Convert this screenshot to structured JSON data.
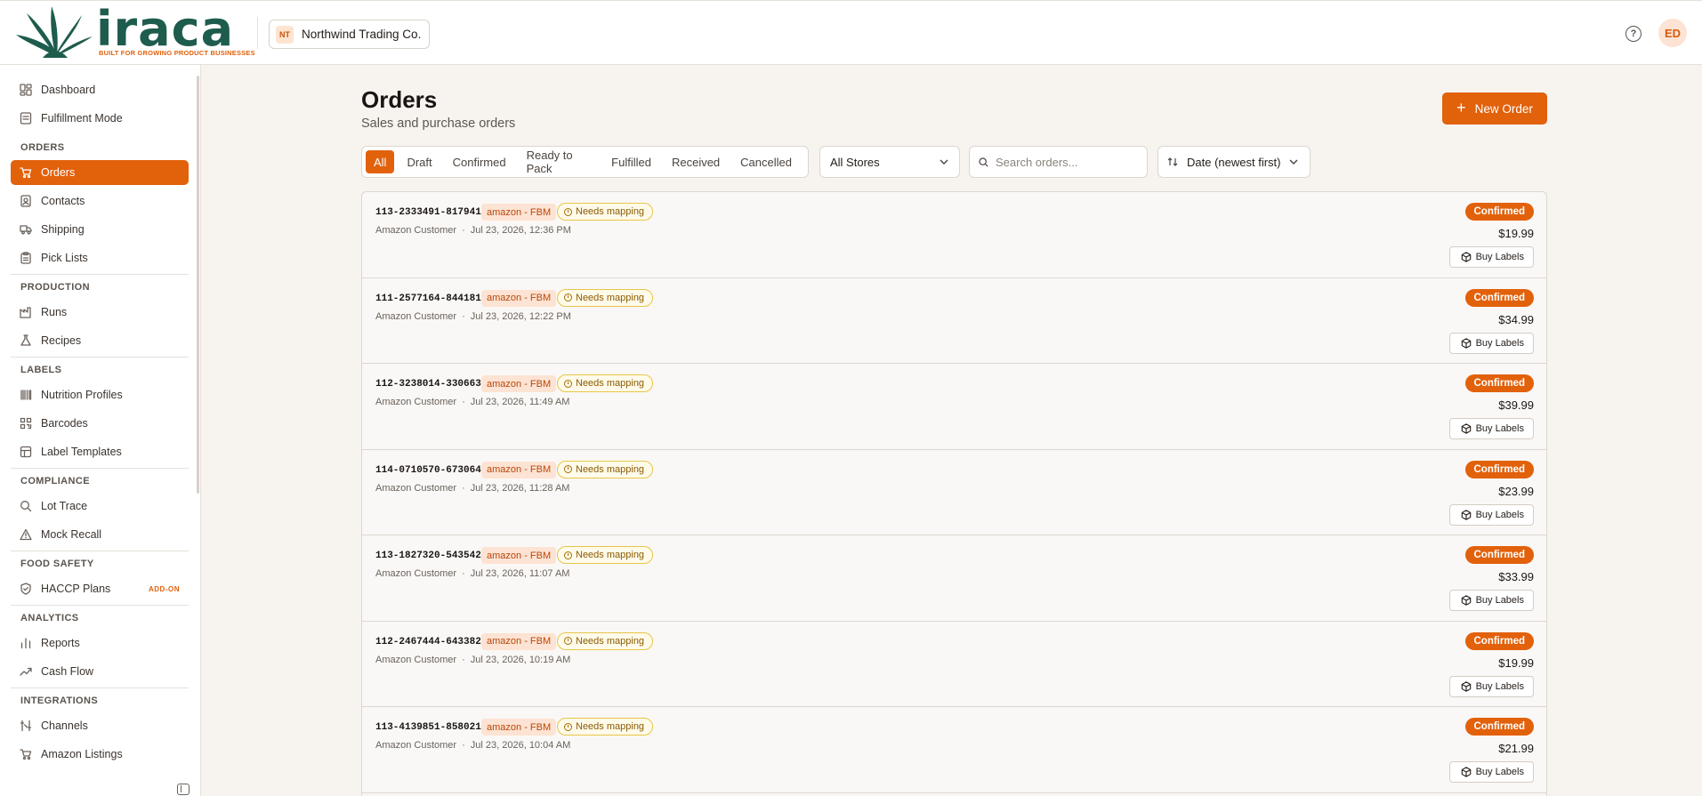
{
  "brand": {
    "name": "iraca",
    "tagline": "BUILT FOR GROWING PRODUCT BUSINESSES"
  },
  "org": {
    "initials": "NT",
    "name": "Northwind Trading Co."
  },
  "user": {
    "initials": "ED"
  },
  "help_glyph": "?",
  "colors": {
    "accent": "#e2610b",
    "brand_green": "#1e5c4d",
    "mapping_border": "#e8c547"
  },
  "sidebar": {
    "items": [
      {
        "type": "item",
        "label": "Dashboard",
        "icon": "dashboard-icon"
      },
      {
        "type": "item",
        "label": "Fulfillment Mode",
        "icon": "fulfillment-icon"
      },
      {
        "type": "section",
        "label": "ORDERS"
      },
      {
        "type": "item",
        "label": "Orders",
        "icon": "cart-icon",
        "active": true
      },
      {
        "type": "item",
        "label": "Contacts",
        "icon": "contacts-icon"
      },
      {
        "type": "item",
        "label": "Shipping",
        "icon": "truck-icon"
      },
      {
        "type": "item",
        "label": "Pick Lists",
        "icon": "clipboard-icon"
      },
      {
        "type": "section",
        "label": "PRODUCTION"
      },
      {
        "type": "item",
        "label": "Runs",
        "icon": "factory-icon"
      },
      {
        "type": "item",
        "label": "Recipes",
        "icon": "flask-icon"
      },
      {
        "type": "section",
        "label": "LABELS"
      },
      {
        "type": "item",
        "label": "Nutrition Profiles",
        "icon": "barcode-icon"
      },
      {
        "type": "item",
        "label": "Barcodes",
        "icon": "qr-icon"
      },
      {
        "type": "item",
        "label": "Label Templates",
        "icon": "template-icon"
      },
      {
        "type": "section",
        "label": "COMPLIANCE"
      },
      {
        "type": "item",
        "label": "Lot Trace",
        "icon": "search-icon"
      },
      {
        "type": "item",
        "label": "Mock Recall",
        "icon": "warning-icon"
      },
      {
        "type": "section",
        "label": "FOOD SAFETY"
      },
      {
        "type": "item",
        "label": "HACCP Plans",
        "icon": "shield-icon",
        "badge": "ADD-ON"
      },
      {
        "type": "section",
        "label": "ANALYTICS"
      },
      {
        "type": "item",
        "label": "Reports",
        "icon": "bar-chart-icon"
      },
      {
        "type": "item",
        "label": "Cash Flow",
        "icon": "trend-icon"
      },
      {
        "type": "section",
        "label": "INTEGRATIONS"
      },
      {
        "type": "item",
        "label": "Channels",
        "icon": "channels-icon"
      },
      {
        "type": "item",
        "label": "Amazon Listings",
        "icon": "cart-icon"
      }
    ]
  },
  "page": {
    "title": "Orders",
    "subtitle": "Sales and purchase orders",
    "new_order_label": "New Order"
  },
  "filters": {
    "tabs": [
      "All",
      "Draft",
      "Confirmed",
      "Ready to Pack",
      "Fulfilled",
      "Received",
      "Cancelled"
    ],
    "active_tab": "All",
    "store": "All Stores",
    "search_placeholder": "Search orders...",
    "sort": "Date (newest first)"
  },
  "orders": [
    {
      "id": "113-2333491-8179414",
      "channel": "amazon - FBM",
      "flag": "Needs mapping",
      "customer": "Amazon Customer",
      "date": "Jul 23, 2026, 12:36 PM",
      "status": "Confirmed",
      "amount": "$19.99",
      "action": "Buy Labels"
    },
    {
      "id": "111-2577164-8441815",
      "channel": "amazon - FBM",
      "flag": "Needs mapping",
      "customer": "Amazon Customer",
      "date": "Jul 23, 2026, 12:22 PM",
      "status": "Confirmed",
      "amount": "$34.99",
      "action": "Buy Labels"
    },
    {
      "id": "112-3238014-3306631",
      "channel": "amazon - FBM",
      "flag": "Needs mapping",
      "customer": "Amazon Customer",
      "date": "Jul 23, 2026, 11:49 AM",
      "status": "Confirmed",
      "amount": "$39.99",
      "action": "Buy Labels"
    },
    {
      "id": "114-0710570-6730640",
      "channel": "amazon - FBM",
      "flag": "Needs mapping",
      "customer": "Amazon Customer",
      "date": "Jul 23, 2026, 11:28 AM",
      "status": "Confirmed",
      "amount": "$23.99",
      "action": "Buy Labels"
    },
    {
      "id": "113-1827320-5435427",
      "channel": "amazon - FBM",
      "flag": "Needs mapping",
      "customer": "Amazon Customer",
      "date": "Jul 23, 2026, 11:07 AM",
      "status": "Confirmed",
      "amount": "$33.99",
      "action": "Buy Labels"
    },
    {
      "id": "112-2467444-6433829",
      "channel": "amazon - FBM",
      "flag": "Needs mapping",
      "customer": "Amazon Customer",
      "date": "Jul 23, 2026, 10:19 AM",
      "status": "Confirmed",
      "amount": "$19.99",
      "action": "Buy Labels"
    },
    {
      "id": "113-4139851-8580211",
      "channel": "amazon - FBM",
      "flag": "Needs mapping",
      "customer": "Amazon Customer",
      "date": "Jul 23, 2026, 10:04 AM",
      "status": "Confirmed",
      "amount": "$21.99",
      "action": "Buy Labels"
    }
  ]
}
